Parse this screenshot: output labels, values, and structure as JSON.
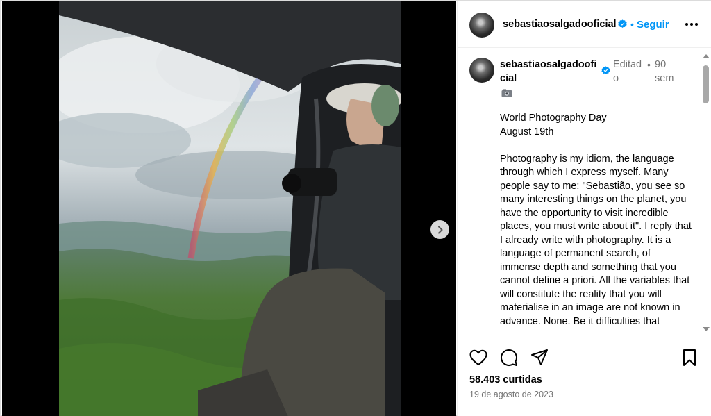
{
  "post": {
    "username": "sebastiaosalgadooficial",
    "follow_label": "Seguir",
    "separator": "•"
  },
  "comment": {
    "username": "sebastiaosalgadooficial",
    "edited_label": "Editado",
    "time_ago": "90 sem",
    "caption": "World Photography Day\nAugust 19th\n\nPhotography is my idiom, the language through which I express myself. Many people say to me: \"Sebastião, you see so many interesting things on the planet, you have the opportunity to visit incredible places, you must write about it\". I reply that I already write with photography. It is a language of permanent search, of immense depth and something that you cannot define a priori. All the variables that will constitute the reality that you will materialise in an image are not known in advance. None. Be it difficulties that"
  },
  "footer": {
    "likes": "58.403 curtidas",
    "date": "19 de agosto de 2023"
  },
  "icons": {
    "verified": "verified-badge-icon",
    "more": "more-options-icon",
    "camera": "camera-emoji-icon",
    "next": "chevron-right-icon",
    "like": "heart-icon",
    "comment": "comment-bubble-icon",
    "share": "paper-plane-icon",
    "save": "bookmark-icon"
  },
  "colors": {
    "accent": "#0095f6",
    "muted": "#737373"
  }
}
